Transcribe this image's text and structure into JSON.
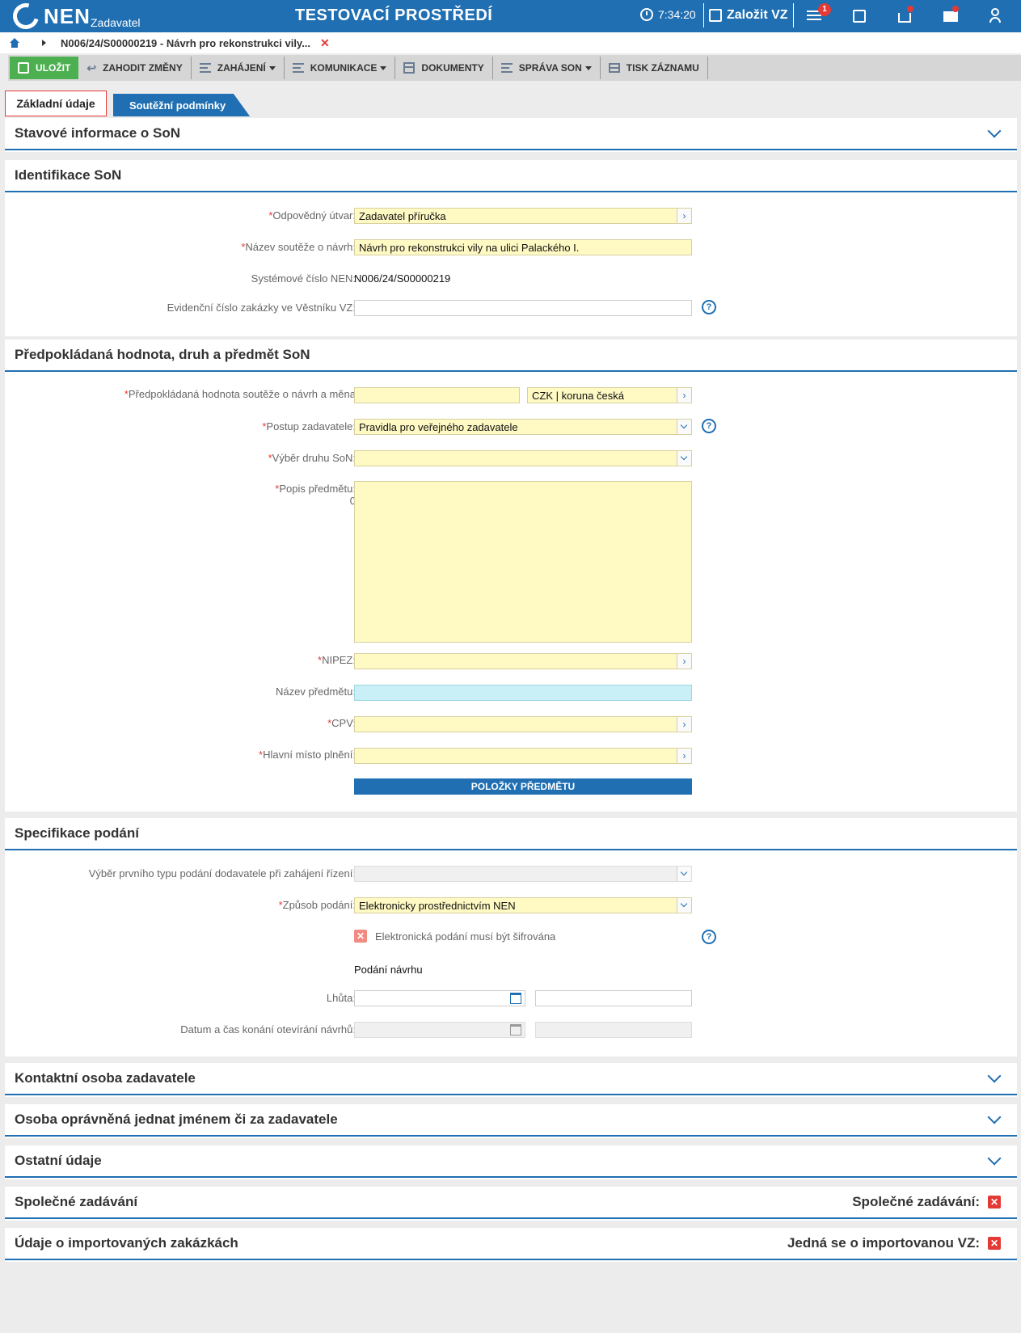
{
  "header": {
    "logo": "NEN",
    "logo_sub": "Zadavatel",
    "env_title": "TESTOVACÍ PROSTŘEDÍ",
    "time": "7:34:20",
    "create_label": "Založit VZ",
    "notification_count": "1"
  },
  "breadcrumb": {
    "current": "N006/24/S00000219 - Návrh pro rekonstrukci vily..."
  },
  "toolbar": {
    "save": "ULOŽIT",
    "discard": "ZAHODIT ZMĚNY",
    "start": "ZAHÁJENÍ",
    "communication": "KOMUNIKACE",
    "documents": "DOKUMENTY",
    "manage": "SPRÁVA SON",
    "print": "TISK ZÁZNAMU"
  },
  "tabs": {
    "basic": "Základní údaje",
    "conditions": "Soutěžní podmínky"
  },
  "sections": {
    "status": "Stavové informace o SoN",
    "identification": "Identifikace SoN",
    "value": "Předpokládaná hodnota, druh a předmět SoN",
    "submission": "Specifikace podání",
    "contact": "Kontaktní osoba zadavatele",
    "authorized": "Osoba oprávněná jednat jménem či za zadavatele",
    "other": "Ostatní údaje",
    "joint": "Společné zadávání",
    "imported": "Údaje o importovaných zakázkách"
  },
  "identification": {
    "unit_label": "Odpovědný útvar:",
    "unit_value": "Zadavatel příručka",
    "name_label": "Název soutěže o návrh:",
    "name_value": "Návrh pro rekonstrukci vily na ulici Palackého I.",
    "sys_label": "Systémové číslo NEN:",
    "sys_value": "N006/24/S00000219",
    "ev_label": "Evidenční číslo zakázky ve Věstníku VZ:",
    "ev_value": ""
  },
  "value_section": {
    "value_label": "Předpokládaná hodnota soutěže o návrh a měna",
    "value_value": "",
    "currency_value": "CZK | koruna česká",
    "procedure_label": "Postup zadavatele:",
    "procedure_value": "Pravidla pro veřejného zadavatele",
    "type_label": "Výběr druhu SoN:",
    "type_value": "",
    "desc_label": "Popis předmětu:",
    "desc_count": "0",
    "desc_value": "",
    "nipez_label": "NIPEZ:",
    "subject_name_label": "Název předmětu:",
    "cpv_label": "CPV:",
    "place_label": "Hlavní místo plnění:",
    "items_button": "POLOŽKY PŘEDMĚTU"
  },
  "submission": {
    "first_type_label": "Výběr prvního typu podání dodavatele při zahájení řízení:",
    "method_label": "Způsob podání:",
    "method_value": "Elektronicky prostřednictvím NEN",
    "encrypted_label": "Elektronická podání musí být šifrována",
    "proposal_heading": "Podání návrhu",
    "deadline_label": "Lhůta:",
    "opening_label": "Datum a čas konání otevírání návrhů:"
  },
  "flags": {
    "joint_label": "Společné zadávání:",
    "imported_label": "Jedná se o importovanou VZ:"
  },
  "colors": {
    "brand": "#1f6fb2",
    "required_field": "#fff9c4",
    "save_button": "#4caf50",
    "error": "#e53935"
  }
}
